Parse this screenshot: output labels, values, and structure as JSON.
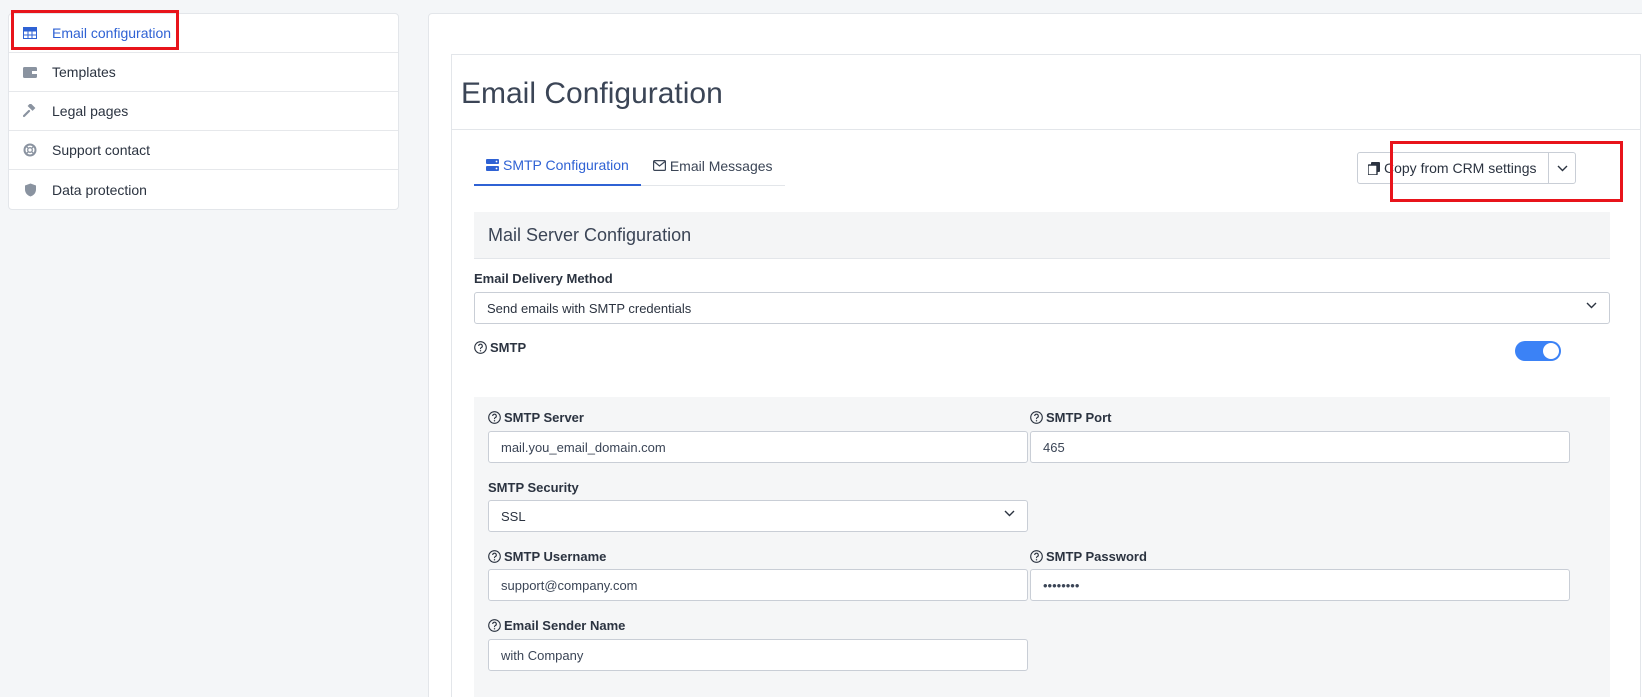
{
  "sidebar": {
    "items": [
      {
        "label": "Email configuration",
        "icon": "table-grid-icon"
      },
      {
        "label": "Templates",
        "icon": "wallet-icon"
      },
      {
        "label": "Legal pages",
        "icon": "gavel-icon"
      },
      {
        "label": "Support contact",
        "icon": "life-ring-icon"
      },
      {
        "label": "Data protection",
        "icon": "shield-icon"
      }
    ]
  },
  "main": {
    "title": "Email Configuration",
    "tabs": [
      {
        "label": "SMTP Configuration",
        "icon": "server-icon"
      },
      {
        "label": "Email Messages",
        "icon": "envelope-icon"
      }
    ],
    "copy_button": {
      "label": "Copy from CRM settings"
    },
    "section_title": "Mail Server Configuration",
    "delivery": {
      "label": "Email Delivery Method",
      "value": "Send emails with SMTP credentials"
    },
    "smtp_toggle": {
      "label": "SMTP",
      "on": true
    },
    "fields": {
      "server": {
        "label": "SMTP Server",
        "value": "mail.you_email_domain.com"
      },
      "port": {
        "label": "SMTP Port",
        "value": "465"
      },
      "security": {
        "label": "SMTP Security",
        "value": "SSL"
      },
      "username": {
        "label": "SMTP Username",
        "value": "support@company.com"
      },
      "password": {
        "label": "SMTP Password",
        "value": "••••••••"
      },
      "sender": {
        "label": "Email Sender Name",
        "value": "with Company"
      }
    }
  },
  "colors": {
    "accent": "#2f62d4",
    "toggle": "#3b82f6",
    "highlight": "#e8141b"
  }
}
